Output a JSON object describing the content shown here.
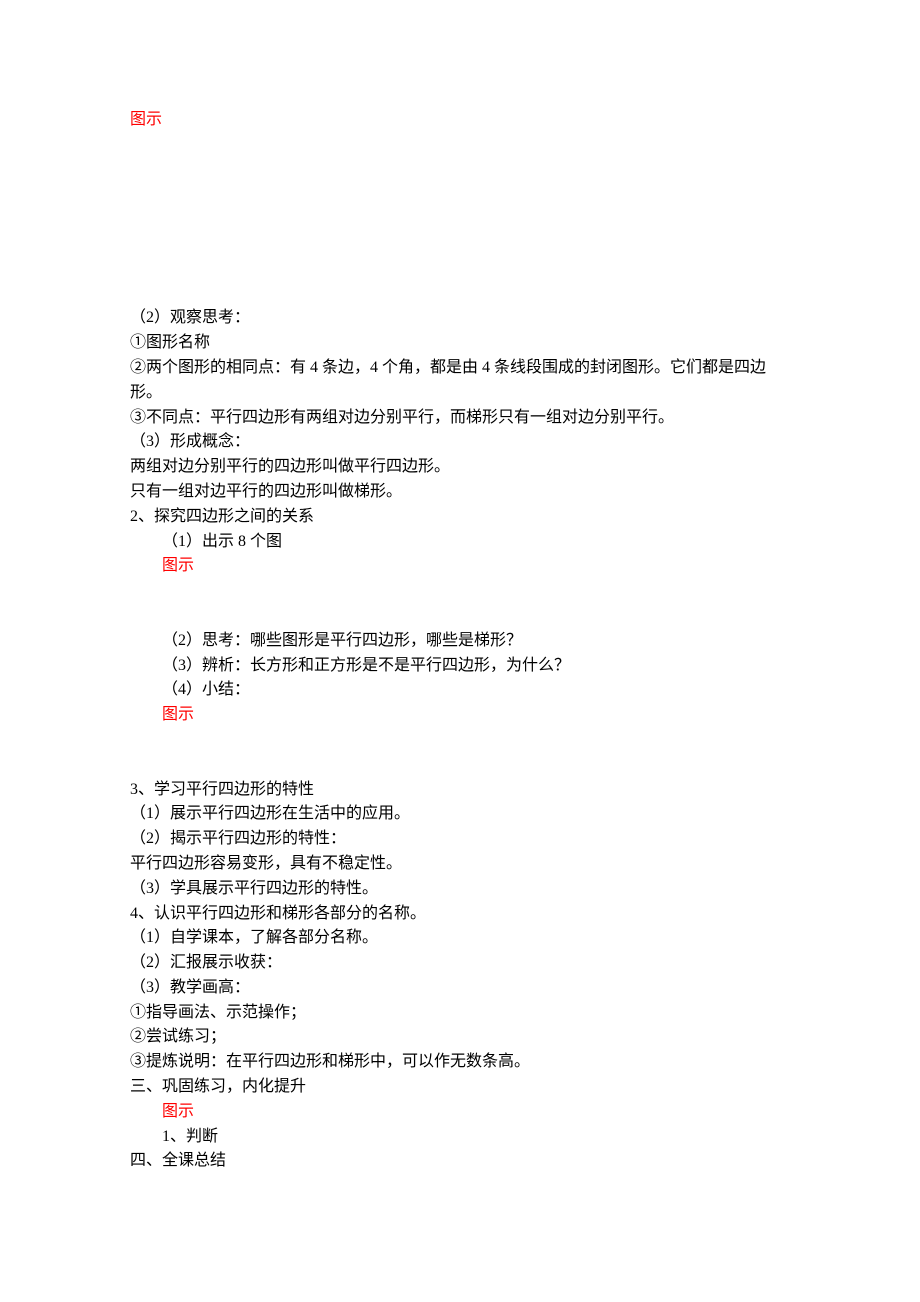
{
  "lines": {
    "l1": "图示",
    "l2": "（2）观察思考：",
    "l3": "①图形名称",
    "l4": "②两个图形的相同点：有 4 条边，4 个角，都是由 4 条线段围成的封闭图形。它们都是四边形。",
    "l5": "③不同点：平行四边形有两组对边分别平行，而梯形只有一组对边分别平行。",
    "l6": "（3）形成概念：",
    "l7": "两组对边分别平行的四边形叫做平行四边形。",
    "l8": "只有一组对边平行的四边形叫做梯形。",
    "l9": "2、探究四边形之间的关系",
    "l10": "（1）出示 8 个图",
    "l11": "图示",
    "l12": "（2）思考：哪些图形是平行四边形，哪些是梯形？",
    "l13": "（3）辨析：长方形和正方形是不是平行四边形，为什么？",
    "l14": "（4）小结：",
    "l15": "图示",
    "l16": "3、学习平行四边形的特性",
    "l17": "（1）展示平行四边形在生活中的应用。",
    "l18": "（2）揭示平行四边形的特性：",
    "l19": "平行四边形容易变形，具有不稳定性。",
    "l20": "（3）学具展示平行四边形的特性。",
    "l21": "4、认识平行四边形和梯形各部分的名称。",
    "l22": "（1）自学课本，了解各部分名称。",
    "l23": "（2）汇报展示收获：",
    "l24": "（3）教学画高：",
    "l25": "①指导画法、示范操作；",
    "l26": "②尝试练习；",
    "l27": "③提炼说明：在平行四边形和梯形中，可以作无数条高。",
    "l28": "三、巩固练习，内化提升",
    "l29": "图示",
    "l30": "1、判断",
    "l31": "四、全课总结"
  }
}
